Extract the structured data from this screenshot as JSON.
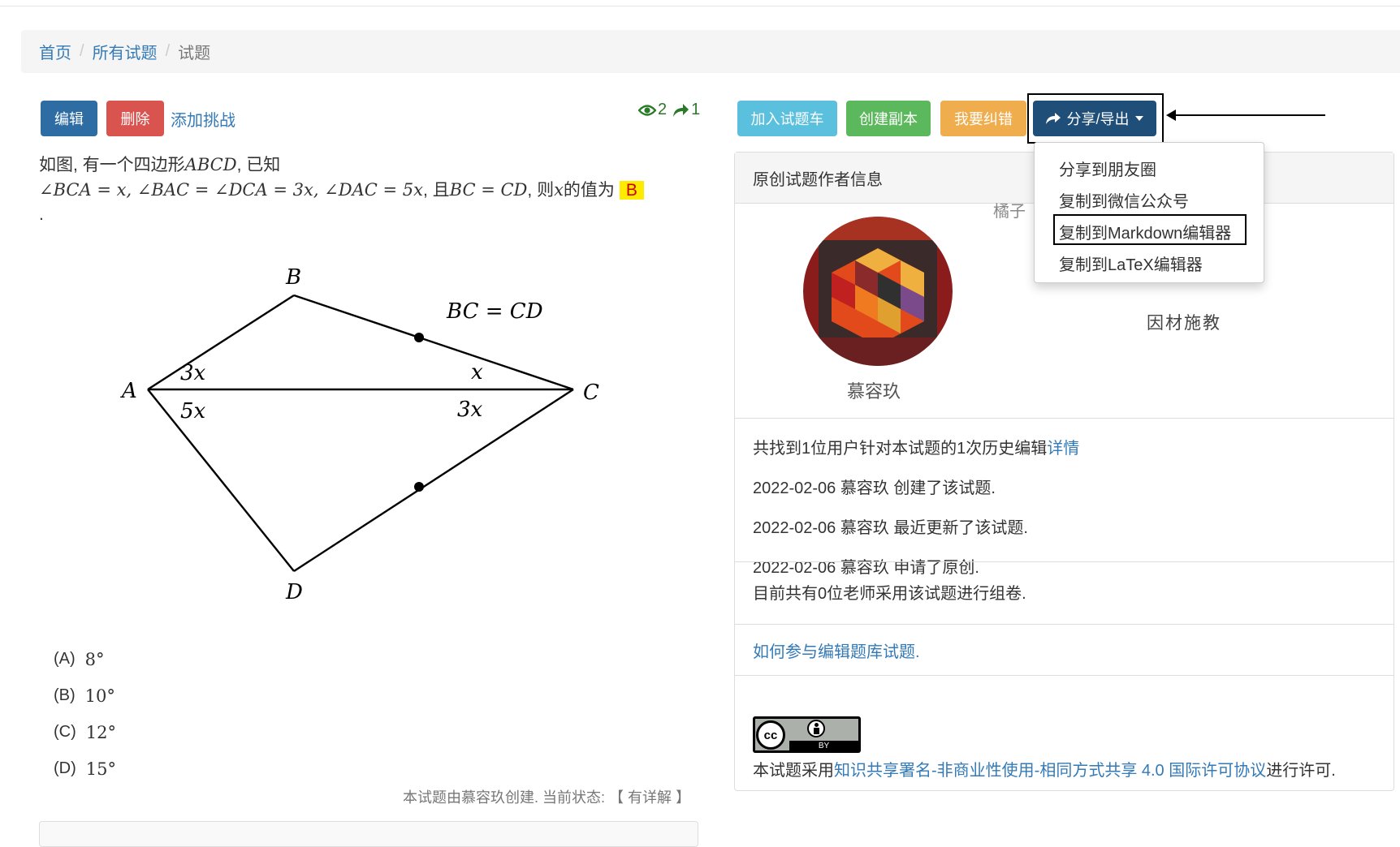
{
  "breadcrumb": {
    "home": "首页",
    "all": "所有试题",
    "current": "试题",
    "sep": "/"
  },
  "actions": {
    "edit": "编辑",
    "delete": "删除",
    "add_challenge": "添加挑战"
  },
  "stats": {
    "views": "2",
    "shares": "1"
  },
  "question": {
    "prefix": "如图, 有一个四边形",
    "shape": "ABCD",
    "suffix1": ", 已知",
    "cond1": "∠BCA = x, ∠BAC = ∠DCA = 3x, ∠DAC = 5x",
    "mid": ", 且",
    "cond2": "BC = CD",
    "tail_pre": ", 则",
    "var": "x",
    "tail_post": "的值为",
    "answer": "B",
    "period": "."
  },
  "figure": {
    "label_A": "A",
    "label_B": "B",
    "label_C": "C",
    "label_D": "D",
    "eq": "BC = CD",
    "ang_BAC": "3x",
    "ang_DAC": "5x",
    "ang_BCA": "x",
    "ang_DCA": "3x"
  },
  "choices": [
    {
      "label": "(A)",
      "value": "8°"
    },
    {
      "label": "(B)",
      "value": "10°"
    },
    {
      "label": "(C)",
      "value": "12°"
    },
    {
      "label": "(D)",
      "value": "15°"
    }
  ],
  "status": {
    "text": "本试题由慕容玖创建. 当前状态:",
    "bracket_open": "【",
    "state": "有详解",
    "bracket_close": "】"
  },
  "toolbar": {
    "add_cart": "加入试题车",
    "copy": "创建副本",
    "report": "我要纠错",
    "share": "分享/导出"
  },
  "dropdown": {
    "items": [
      "分享到朋友圈",
      "复制到微信公众号",
      "复制到Markdown编辑器",
      "复制到LaTeX编辑器"
    ]
  },
  "author": {
    "heading": "原创试题作者信息",
    "name": "慕容玖",
    "partial": "橘子",
    "motto": "因材施教"
  },
  "history": {
    "summary": "共找到1位用户针对本试题的1次历史编辑",
    "detail_link": "详情",
    "entries": [
      "2022-02-06 慕容玖 创建了该试题.",
      "2022-02-06 慕容玖 最近更新了该试题.",
      "2022-02-06 慕容玖 申请了原创."
    ]
  },
  "usage": "目前共有0位老师采用该试题进行组卷.",
  "help_link": "如何参与编辑题库试题.",
  "license": {
    "prefix": "本试题采用",
    "link": "知识共享署名-非商业性使用-相同方式共享 4.0 国际许可协议",
    "suffix": "进行许可.",
    "badge_cc": "cc",
    "badge_by": "BY"
  },
  "colors": {
    "link": "#337ab7",
    "primary": "#2e6da4",
    "danger": "#d9534f",
    "info": "#5bc0de",
    "success": "#5cb85c",
    "warning": "#f0ad4e",
    "share": "#1f4e79"
  }
}
